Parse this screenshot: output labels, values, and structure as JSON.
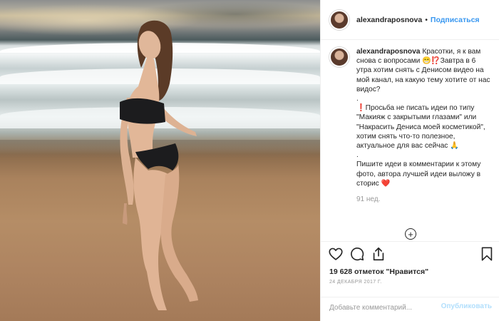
{
  "post": {
    "username": "alexandraposnova",
    "follow_label": "Подписаться",
    "dot": "•"
  },
  "caption": {
    "username": "alexandraposnova",
    "line1": "Красотки, я к вам снова с вопросами 😁⁉️Завтра в 6 утра хотим снять с Денисом видео на мой канал, на какую тему хотите от нас видос?",
    "dot1": ".",
    "line2": "❗Просьба не писать идеи по типу \"Макияж с закрытыми глазами\" или \"Накрасить Дениса моей косметикой\", хотим снять что-то полезное, актуальное для вас сейчас 🙏",
    "dot2": ".",
    "line3": "Пишите идеи в комментарии к этому фото, автора лучшей идеи выложу в сторис ❤️",
    "time_ago": "91 нед."
  },
  "more": {
    "label": "+"
  },
  "stats": {
    "likes": "19 628 отметок \"Нравится\"",
    "date": "24 ДЕКАБРЯ 2017 Г."
  },
  "comment": {
    "placeholder": "Добавьте комментарий...",
    "publish_label": "Опубликовать"
  },
  "icons": {
    "like": "heart-icon",
    "comment": "comment-icon",
    "share": "share-icon",
    "save": "bookmark-icon"
  },
  "colors": {
    "link": "#3897f0",
    "publish_disabled": "#b2dffc",
    "text": "#262626",
    "muted": "#999999"
  }
}
